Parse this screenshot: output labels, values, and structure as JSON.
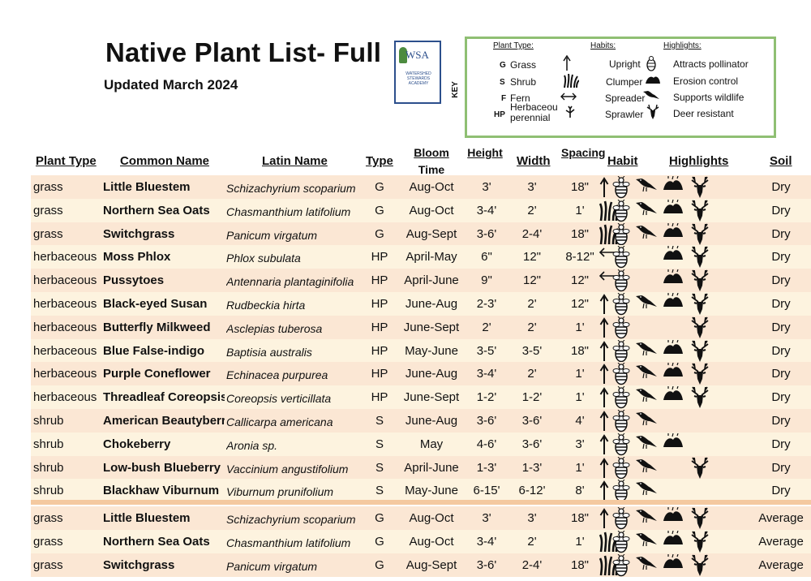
{
  "header": {
    "title": "Native Plant List- Full",
    "subtitle": "Updated March 2024",
    "logo_text": "WSA",
    "logo_lines": "WATERSHED STEWARDS ACADEMY"
  },
  "key": {
    "label": "KEY",
    "plant_type_header": "Plant Type:",
    "habits_header": "Habits:",
    "highlights_header": "Highlights:",
    "plant_types": [
      {
        "code": "G",
        "label": "Grass"
      },
      {
        "code": "S",
        "label": "Shrub"
      },
      {
        "code": "F",
        "label": "Fern"
      },
      {
        "code": "HP",
        "label": "Herbaceous perennial"
      }
    ],
    "habits": [
      "Upright",
      "Clumper",
      "Spreader",
      "Sprawler"
    ],
    "highlights": [
      "Attracts pollinator",
      "Erosion control",
      "Supports wildlife",
      "Deer resistant"
    ]
  },
  "table": {
    "headers": {
      "plant_type": "Plant Type",
      "common_name": "Common Name",
      "latin_name": "Latin Name",
      "type": "Type",
      "bloom_time": "Bloom Time",
      "height": "Height",
      "width": "Width",
      "spacing": "Spacing",
      "habit": "Habit",
      "highlights": "Highlights",
      "soil": "Soil"
    },
    "rows": [
      {
        "plant_type": "grass",
        "common": "Little Bluestem",
        "latin": "Schizachyrium scoparium",
        "type": "G",
        "bloom": "Aug-Oct",
        "height": "3'",
        "width": "3'",
        "spacing": "18\"",
        "habit": "upright-icon",
        "highlights": [
          "pollinator",
          "wildlife",
          "erosion",
          "deer"
        ],
        "soil": "Dry"
      },
      {
        "plant_type": "grass",
        "common": "Northern Sea Oats",
        "latin": "Chasmanthium latifolium",
        "type": "G",
        "bloom": "Aug-Oct",
        "height": "3-4'",
        "width": "2'",
        "spacing": "1'",
        "habit": "clumper-icon",
        "highlights": [
          "pollinator",
          "wildlife",
          "erosion",
          "deer"
        ],
        "soil": "Dry"
      },
      {
        "plant_type": "grass",
        "common": "Switchgrass",
        "latin": "Panicum virgatum",
        "type": "G",
        "bloom": "Aug-Sept",
        "height": "3-6'",
        "width": "2-4'",
        "spacing": "18\"",
        "habit": "clumper-icon",
        "highlights": [
          "pollinator",
          "wildlife",
          "erosion",
          "deer"
        ],
        "soil": "Dry"
      },
      {
        "plant_type": "herbaceous",
        "common": "Moss Phlox",
        "latin": "Phlox subulata",
        "type": "HP",
        "bloom": "April-May",
        "height": "6\"",
        "width": "12\"",
        "spacing": "8-12\"",
        "habit": "spreader-icon",
        "highlights": [
          "pollinator",
          "erosion",
          "deer"
        ],
        "soil": "Dry"
      },
      {
        "plant_type": "herbaceous",
        "common": "Pussytoes",
        "latin": "Antennaria plantaginifolia",
        "type": "HP",
        "bloom": "April-June",
        "height": "9\"",
        "width": "12\"",
        "spacing": "12\"",
        "habit": "spreader-icon",
        "highlights": [
          "pollinator",
          "erosion",
          "deer"
        ],
        "soil": "Dry"
      },
      {
        "plant_type": "herbaceous",
        "common": "Black-eyed Susan",
        "latin": "Rudbeckia hirta",
        "type": "HP",
        "bloom": "June-Aug",
        "height": "2-3'",
        "width": "2'",
        "spacing": "12\"",
        "habit": "upright-icon",
        "highlights": [
          "pollinator",
          "wildlife",
          "erosion",
          "deer"
        ],
        "soil": "Dry"
      },
      {
        "plant_type": "herbaceous",
        "common": "Butterfly Milkweed",
        "latin": "Asclepias tuberosa",
        "type": "HP",
        "bloom": "June-Sept",
        "height": "2'",
        "width": "2'",
        "spacing": "1'",
        "habit": "upright-icon",
        "highlights": [
          "pollinator",
          "deer"
        ],
        "soil": "Dry"
      },
      {
        "plant_type": "herbaceous",
        "common": "Blue False-indigo",
        "latin": "Baptisia australis",
        "type": "HP",
        "bloom": "May-June",
        "height": "3-5'",
        "width": "3-5'",
        "spacing": "18\"",
        "habit": "upright-icon",
        "highlights": [
          "pollinator",
          "wildlife",
          "erosion",
          "deer"
        ],
        "soil": "Dry"
      },
      {
        "plant_type": "herbaceous",
        "common": "Purple Coneflower",
        "latin": "Echinacea purpurea",
        "type": "HP",
        "bloom": "June-Aug",
        "height": "3-4'",
        "width": "2'",
        "spacing": "1'",
        "habit": "upright-icon",
        "highlights": [
          "pollinator",
          "wildlife",
          "erosion",
          "deer"
        ],
        "soil": "Dry"
      },
      {
        "plant_type": "herbaceous",
        "common": "Threadleaf Coreopsis",
        "latin": "Coreopsis verticillata",
        "type": "HP",
        "bloom": "June-Sept",
        "height": "1-2'",
        "width": "1-2'",
        "spacing": "1'",
        "habit": "upright-icon",
        "highlights": [
          "pollinator",
          "wildlife",
          "erosion",
          "deer"
        ],
        "soil": "Dry"
      },
      {
        "plant_type": "shrub",
        "common": "American Beautyberry",
        "latin": "Callicarpa americana",
        "type": "S",
        "bloom": "June-Aug",
        "height": "3-6'",
        "width": "3-6'",
        "spacing": "4'",
        "habit": "upright-icon",
        "highlights": [
          "pollinator",
          "wildlife"
        ],
        "soil": "Dry"
      },
      {
        "plant_type": "shrub",
        "common": "Chokeberry",
        "latin": "Aronia sp.",
        "type": "S",
        "bloom": "May",
        "height": "4-6'",
        "width": "3-6'",
        "spacing": "3'",
        "habit": "upright-icon",
        "highlights": [
          "pollinator",
          "wildlife",
          "erosion"
        ],
        "soil": "Dry"
      },
      {
        "plant_type": "shrub",
        "common": "Low-bush Blueberry",
        "latin": "Vaccinium angustifolium",
        "type": "S",
        "bloom": "April-June",
        "height": "1-3'",
        "width": "1-3'",
        "spacing": "1'",
        "habit": "upright-icon",
        "highlights": [
          "pollinator",
          "wildlife",
          "deer"
        ],
        "soil": "Dry"
      },
      {
        "plant_type": "shrub",
        "common": "Blackhaw Viburnum",
        "latin": "Viburnum prunifolium",
        "type": "S",
        "bloom": "May-June",
        "height": "6-15'",
        "width": "6-12'",
        "spacing": "8'",
        "habit": "upright-icon",
        "highlights": [
          "pollinator",
          "wildlife"
        ],
        "soil": "Dry"
      },
      {
        "plant_type": "grass",
        "common": "Little Bluestem",
        "latin": "Schizachyrium scoparium",
        "type": "G",
        "bloom": "Aug-Oct",
        "height": "3'",
        "width": "3'",
        "spacing": "18\"",
        "habit": "upright-icon",
        "highlights": [
          "pollinator",
          "wildlife",
          "erosion",
          "deer"
        ],
        "soil": "Average"
      },
      {
        "plant_type": "grass",
        "common": "Northern Sea Oats",
        "latin": "Chasmanthium latifolium",
        "type": "G",
        "bloom": "Aug-Oct",
        "height": "3-4'",
        "width": "2'",
        "spacing": "1'",
        "habit": "clumper-icon",
        "highlights": [
          "pollinator",
          "wildlife",
          "erosion",
          "deer"
        ],
        "soil": "Average"
      },
      {
        "plant_type": "grass",
        "common": "Switchgrass",
        "latin": "Panicum virgatum",
        "type": "G",
        "bloom": "Aug-Sept",
        "height": "3-6'",
        "width": "2-4'",
        "spacing": "18\"",
        "habit": "clumper-icon",
        "highlights": [
          "pollinator",
          "wildlife",
          "erosion",
          "deer"
        ],
        "soil": "Average"
      }
    ]
  },
  "colors": {
    "key_border": "#8fbf73",
    "row_tint_a": "#fbe7d4",
    "row_tint_b": "#fdf3df",
    "separator": "#f4c9a0"
  }
}
